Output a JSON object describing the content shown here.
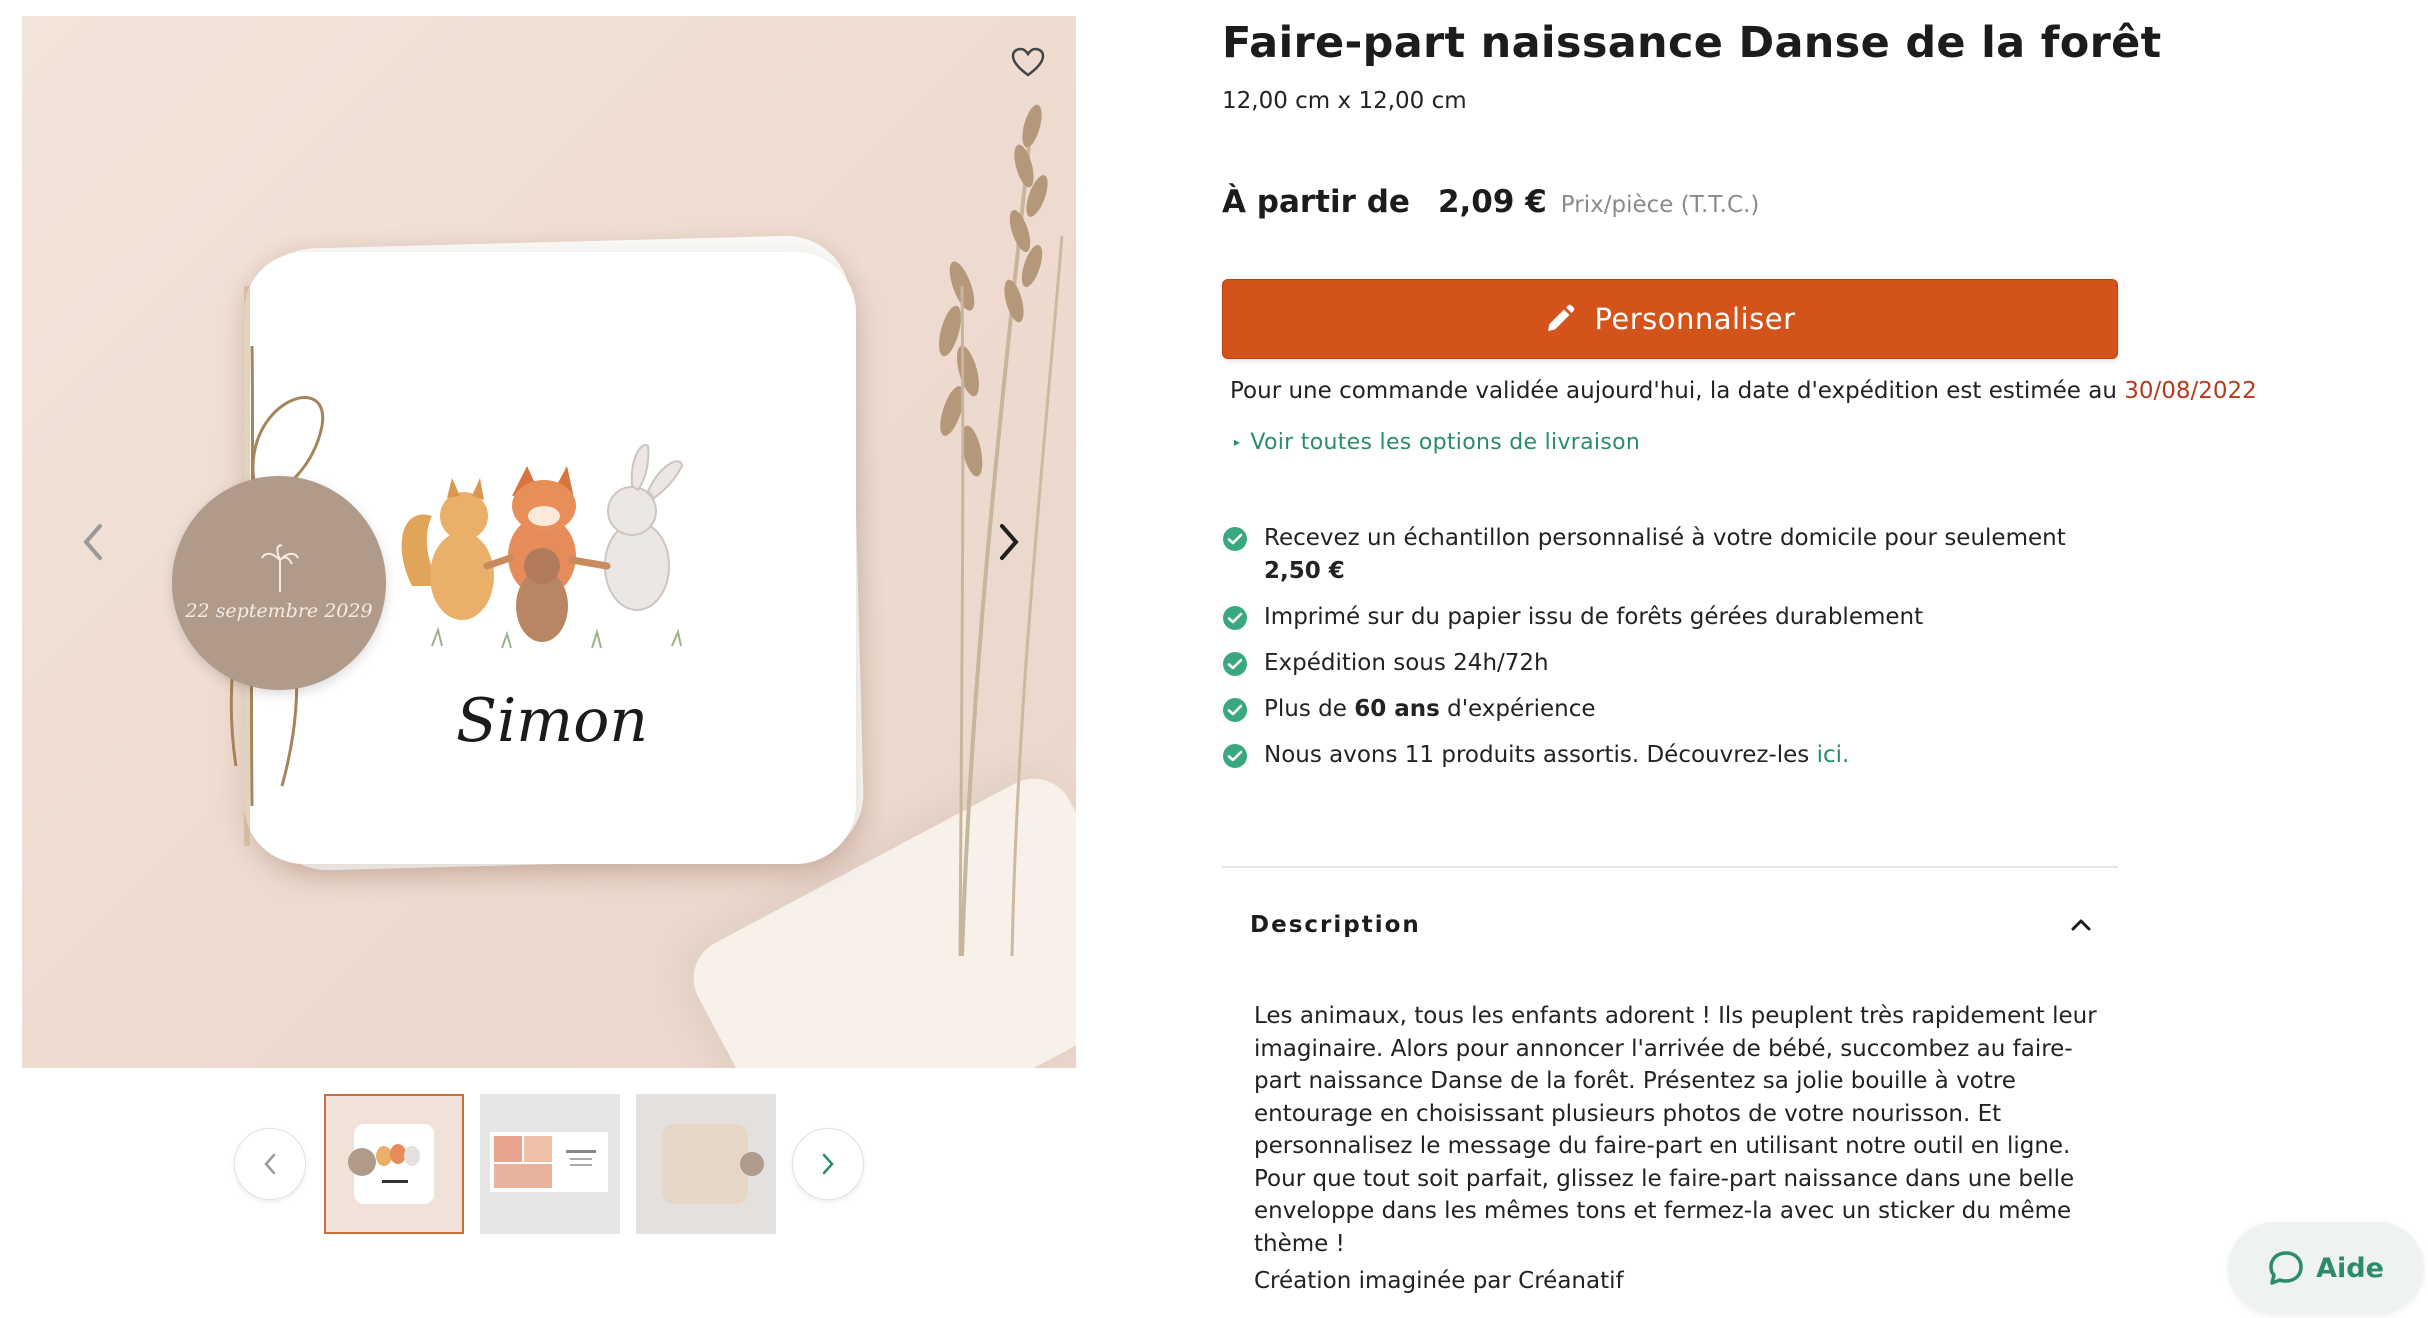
{
  "product": {
    "title": "Faire-part naissance Danse de la forêt",
    "dimensions": "12,00 cm x 12,00 cm",
    "price_prefix": "À partir de",
    "price": "2,09 €",
    "price_unit": "Prix/pièce (T.T.C.)"
  },
  "gallery": {
    "card_name": "Simon",
    "tag_date": "22 septembre 2029",
    "thumbnail_count": 3,
    "selected_thumbnail": 1
  },
  "cta": {
    "label": "Personnaliser",
    "icon": "pencil-icon"
  },
  "shipping": {
    "text": "Pour une commande validée aujourd'hui, la date d'expédition est estimée au ",
    "date": "30/08/2022",
    "options_link": "Voir toutes les options de livraison"
  },
  "benefits": {
    "b1_text": "Recevez un échantillon personnalisé à votre domicile pour seulement",
    "b1_price": "2,50 €",
    "b2_text": "Imprimé sur du papier issu de forêts gérées durablement",
    "b3_text": "Expédition sous 24h/72h",
    "b4_pre": "Plus de ",
    "b4_bold": "60 ans",
    "b4_post": " d'expérience",
    "b5_text": "Nous avons 11 produits assortis. Découvrez-les ",
    "b5_link": "ici."
  },
  "description": {
    "title": "Description",
    "body": "Les animaux, tous les enfants adorent ! Ils peuplent très rapidement leur imaginaire. Alors pour annoncer l'arrivée de bébé, succombez au faire-part naissance Danse de la forêt. Présentez sa jolie bouille à votre entourage en choisissant plusieurs photos de votre nourisson. Et personnalisez le message du faire-part en utilisant notre outil en ligne. Pour que tout soit parfait, glissez le faire-part naissance dans une belle enveloppe dans les mêmes tons et fermez-la avec un sticker du même thème !",
    "credit": "Création imaginée par Créanatif"
  },
  "help": {
    "label": "Aide",
    "icon": "chat-bubble-icon"
  },
  "colors": {
    "cta_orange": "#d4531a",
    "accent_green": "#2a8c6d",
    "date_red": "#b53b1d",
    "check_green": "#3aa87e"
  }
}
